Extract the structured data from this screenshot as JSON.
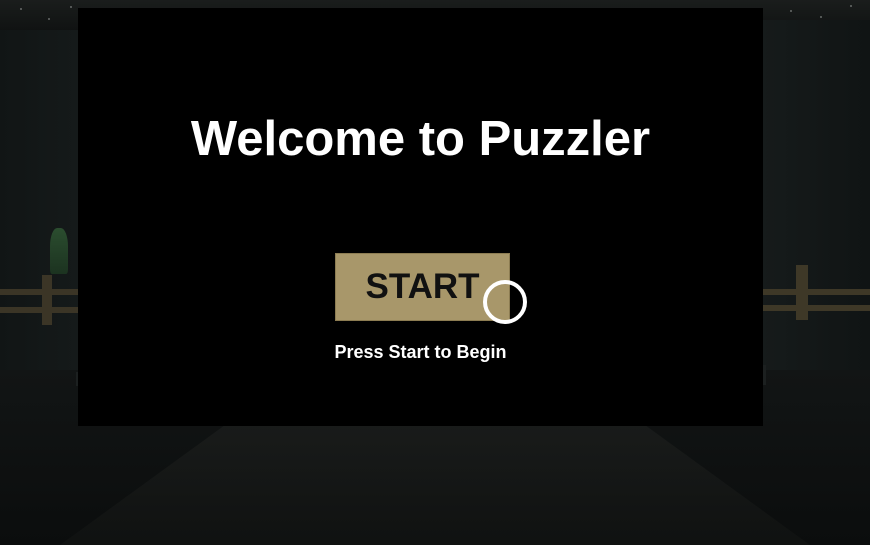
{
  "menu": {
    "title": "Welcome to Puzzler",
    "start_label": "START",
    "subtitle": "Press Start to Begin"
  },
  "colors": {
    "panel_background": "#000000",
    "button_fill": "#a8976a",
    "button_text": "#111111",
    "title_text": "#ffffff",
    "reticle": "#ffffff"
  },
  "icons": {
    "reticle": "gaze-reticle-icon"
  }
}
